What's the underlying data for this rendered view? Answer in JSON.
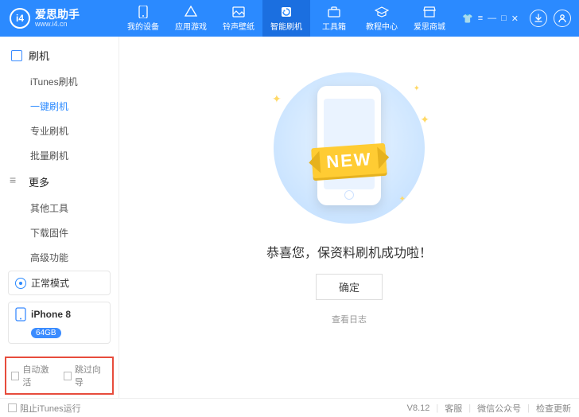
{
  "brand": {
    "name": "爱思助手",
    "sub": "www.i4.cn",
    "logo": "i4"
  },
  "topnav": {
    "items": [
      {
        "label": "我的设备"
      },
      {
        "label": "应用游戏"
      },
      {
        "label": "铃声壁纸"
      },
      {
        "label": "智能刷机"
      },
      {
        "label": "工具箱"
      },
      {
        "label": "教程中心"
      },
      {
        "label": "爱思商城"
      }
    ],
    "active": 3
  },
  "sidebar": {
    "sections": [
      {
        "title": "刷机",
        "items": [
          "iTunes刷机",
          "一键刷机",
          "专业刷机",
          "批量刷机"
        ],
        "active": 1
      },
      {
        "title": "更多",
        "items": [
          "其他工具",
          "下载固件",
          "高级功能"
        ],
        "active": -1
      }
    ],
    "mode": {
      "label": "正常模式"
    },
    "device": {
      "name": "iPhone 8",
      "storage": "64GB"
    },
    "options": {
      "auto_activate": "自动激活",
      "skip_guide": "跳过向导"
    }
  },
  "main": {
    "ribbon": "NEW",
    "message": "恭喜您，保资料刷机成功啦！",
    "ok": "确定",
    "view_log": "查看日志"
  },
  "status": {
    "block_itunes": "阻止iTunes运行",
    "version": "V8.12",
    "support": "客服",
    "wechat": "微信公众号",
    "update": "检查更新"
  }
}
